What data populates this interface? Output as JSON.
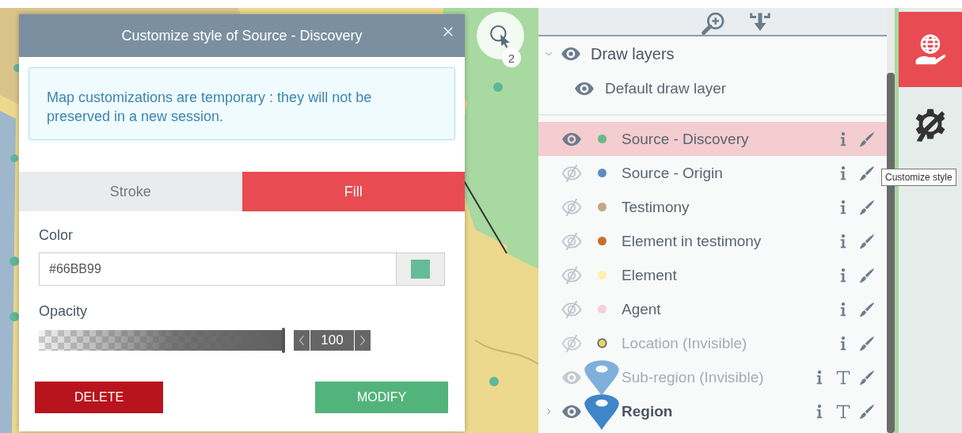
{
  "map": {
    "selection_count": "2"
  },
  "dialog": {
    "title": "Customize style of Source - Discovery",
    "notice": "Map customizations are temporary : they will not be preserved in a new session.",
    "tabs": [
      {
        "label": "Stroke",
        "selected": false
      },
      {
        "label": "Fill",
        "selected": true
      }
    ],
    "color": {
      "label": "Color",
      "value": "#66BB99"
    },
    "opacity": {
      "label": "Opacity",
      "level": 1,
      "reading": "100"
    },
    "buttons": [
      {
        "label": "DELETE",
        "kind": "danger"
      },
      {
        "label": "MODIFY",
        "kind": "confirm"
      }
    ]
  },
  "layers_panel": {
    "groups": [
      {
        "name": "Draw layers",
        "expanded": true,
        "visible": true,
        "children": [
          {
            "name": "Default draw layer",
            "visible": true
          }
        ]
      }
    ],
    "layers": [
      {
        "name": "Source - Discovery",
        "kind": "dot",
        "color": "#66bb88",
        "visible": true,
        "selected": true,
        "disabled": false,
        "text_tool": false
      },
      {
        "name": "Source - Origin",
        "kind": "dot",
        "color": "#5b8fbf",
        "visible": false,
        "selected": false,
        "disabled": false,
        "text_tool": false
      },
      {
        "name": "Testimony",
        "kind": "dot",
        "color": "#bfa98a",
        "visible": false,
        "selected": false,
        "disabled": false,
        "text_tool": false
      },
      {
        "name": "Element in testimony",
        "kind": "dot",
        "color": "#c8702a",
        "visible": false,
        "selected": false,
        "disabled": false,
        "text_tool": false
      },
      {
        "name": "Element",
        "kind": "dot",
        "color": "#fcf2b0",
        "visible": false,
        "selected": false,
        "disabled": false,
        "text_tool": false
      },
      {
        "name": "Agent",
        "kind": "dot",
        "color": "#f5d0d8",
        "visible": false,
        "selected": false,
        "disabled": false,
        "text_tool": false
      },
      {
        "name": "Location (Invisible)",
        "kind": "dot",
        "color": "#e3d66a",
        "visible": false,
        "selected": false,
        "disabled": true,
        "text_tool": false
      },
      {
        "name": "Sub-region (Invisible)",
        "kind": "pin",
        "color": "#7fb0dc",
        "visible": true,
        "selected": false,
        "disabled": true,
        "text_tool": true
      },
      {
        "name": "Region",
        "kind": "group",
        "color": "#3f86c8",
        "visible": true,
        "selected": false,
        "disabled": false,
        "text_tool": true
      }
    ]
  },
  "sidebar": [
    {
      "kind": "globe",
      "selected": true
    },
    {
      "kind": "gear",
      "selected": false
    }
  ],
  "tooltip": "Customize style"
}
